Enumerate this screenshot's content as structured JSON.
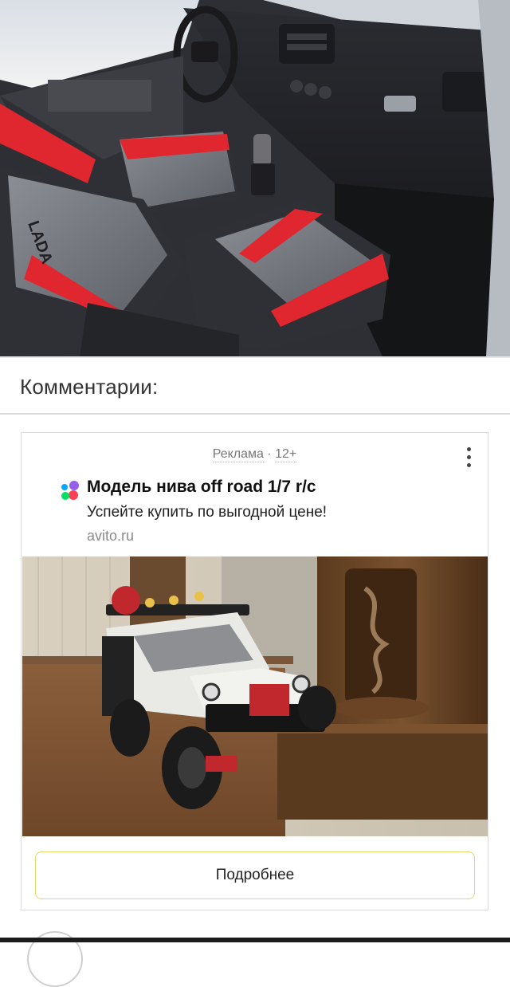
{
  "hero_image": {
    "alt": "car-interior-photo"
  },
  "comments": {
    "title": "Комментарии:"
  },
  "ad": {
    "label": "Реклама",
    "separator": " · ",
    "age": "12+",
    "title": "Модель нива off road 1/7 r/c",
    "subtitle": "Успейте купить по выгодной цене!",
    "domain": "avito.ru",
    "cta_label": "Подробнее",
    "accent_color": "#e8d867",
    "more_icon": "more-vertical-icon",
    "logo_icon": "avito-logo-icon"
  }
}
